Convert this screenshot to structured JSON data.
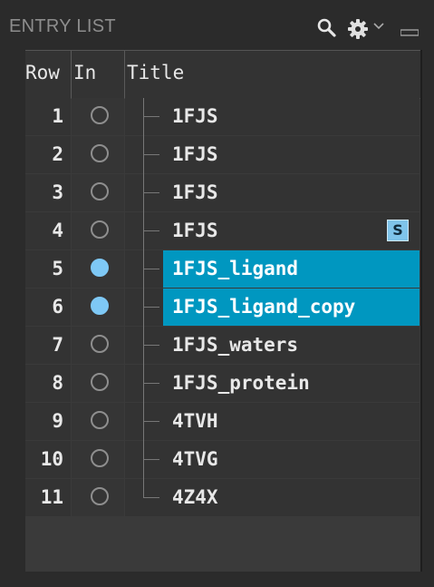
{
  "panel": {
    "title": "ENTRY LIST"
  },
  "toolbar": {
    "search_icon": "search-icon",
    "settings_icon": "gear-icon",
    "menu_icon": "chevron-down-icon",
    "minimize_icon": "minimize-icon"
  },
  "table": {
    "headers": {
      "row": "Row",
      "in": "In",
      "title": "Title"
    },
    "rows": [
      {
        "row": "1",
        "in": false,
        "title": "1FJS",
        "selected": false,
        "badge": ""
      },
      {
        "row": "2",
        "in": false,
        "title": "1FJS",
        "selected": false,
        "badge": ""
      },
      {
        "row": "3",
        "in": false,
        "title": "1FJS",
        "selected": false,
        "badge": ""
      },
      {
        "row": "4",
        "in": false,
        "title": "1FJS",
        "selected": false,
        "badge": "S"
      },
      {
        "row": "5",
        "in": true,
        "title": "1FJS_ligand",
        "selected": true,
        "badge": ""
      },
      {
        "row": "6",
        "in": true,
        "title": "1FJS_ligand_copy",
        "selected": true,
        "badge": ""
      },
      {
        "row": "7",
        "in": false,
        "title": "1FJS_waters",
        "selected": false,
        "badge": ""
      },
      {
        "row": "8",
        "in": false,
        "title": "1FJS_protein",
        "selected": false,
        "badge": ""
      },
      {
        "row": "9",
        "in": false,
        "title": "4TVH",
        "selected": false,
        "badge": ""
      },
      {
        "row": "10",
        "in": false,
        "title": "4TVG",
        "selected": false,
        "badge": ""
      },
      {
        "row": "11",
        "in": false,
        "title": "4Z4X",
        "selected": false,
        "badge": ""
      }
    ]
  },
  "colors": {
    "selected_bg": "#0097c0",
    "included_dot": "#7ec8f5",
    "badge_bg": "#7fc4ea"
  }
}
